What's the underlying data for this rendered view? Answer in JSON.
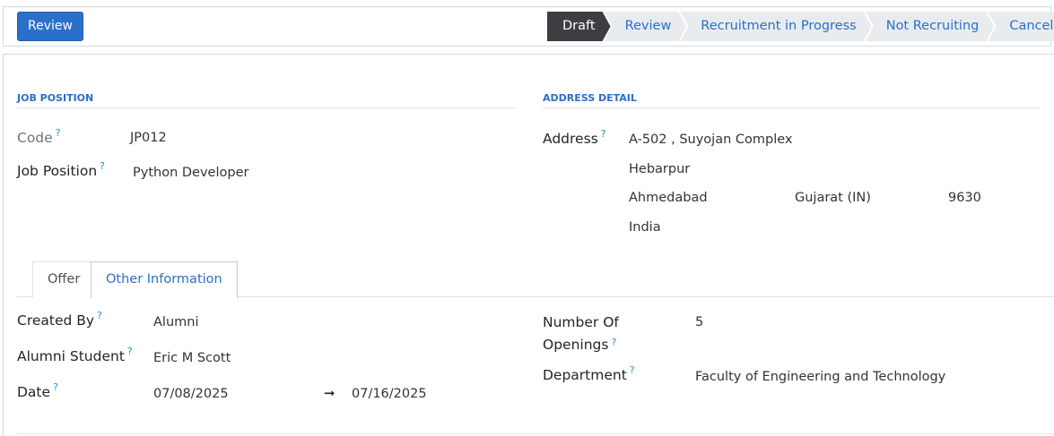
{
  "toolbar": {
    "review_button": "Review"
  },
  "statusbar": {
    "stages": [
      "Draft",
      "Review",
      "Recruitment in Progress",
      "Not Recruiting",
      "Cancel"
    ],
    "active_stage": "Draft"
  },
  "job_position_group": {
    "title": "JOB POSITION",
    "code_label": "Code",
    "code_value": "JP012",
    "job_position_label": "Job Position",
    "job_position_value": "Python Developer"
  },
  "address_group": {
    "title": "ADDRESS DETAIL",
    "address_label": "Address",
    "street": "A-502 , Suyojan Complex",
    "street2": "Hebarpur",
    "city": "Ahmedabad",
    "state": "Gujarat (IN)",
    "zip": "9630",
    "country": "India"
  },
  "tabs": {
    "offer": "Offer",
    "other_information": "Other Information",
    "active": "Other Information"
  },
  "other_information": {
    "created_by_label": "Created By",
    "created_by_value": "Alumni",
    "alumni_student_label": "Alumni Student",
    "alumni_student_value": "Eric M Scott",
    "date_label": "Date",
    "date_start": "07/08/2025",
    "date_end": "07/16/2025",
    "date_arrow": "➞",
    "openings_label_line1": "Number Of",
    "openings_label_line2": "Openings",
    "openings_value": "5",
    "department_label": "Department",
    "department_value": "Faculty of Engineering and Technology"
  },
  "help_marker": "?",
  "colors": {
    "primary": "#2a6fc9",
    "active_stage": "#3c3e42",
    "stage_bg": "#e9ecef"
  }
}
